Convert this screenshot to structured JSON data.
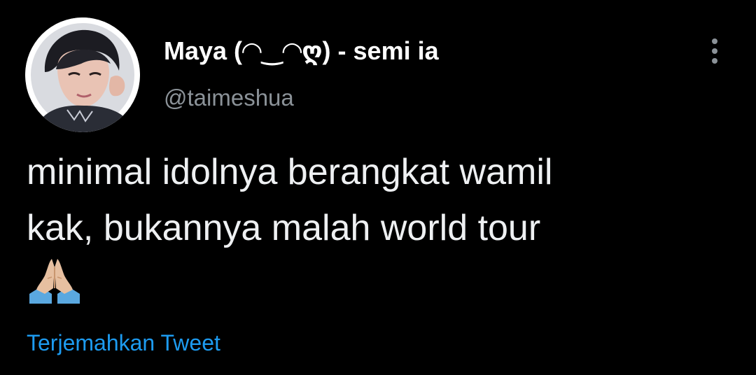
{
  "tweet": {
    "display_name": "Maya (◠‿◠ღ) - semi ia",
    "handle": "@taimeshua",
    "text": "minimal idolnya berangkat wamil\nkak, bukannya malah world tour",
    "emoji": "🙏",
    "translate_label": "Terjemahkan Tweet"
  },
  "icons": {
    "avatar": "profile-photo",
    "menu": "more-options-vertical-icon",
    "emoji": "folded-hands-icon"
  },
  "colors": {
    "background": "#000000",
    "text": "#ffffff",
    "secondary_text": "#8b9298",
    "link": "#1d9bf0"
  }
}
